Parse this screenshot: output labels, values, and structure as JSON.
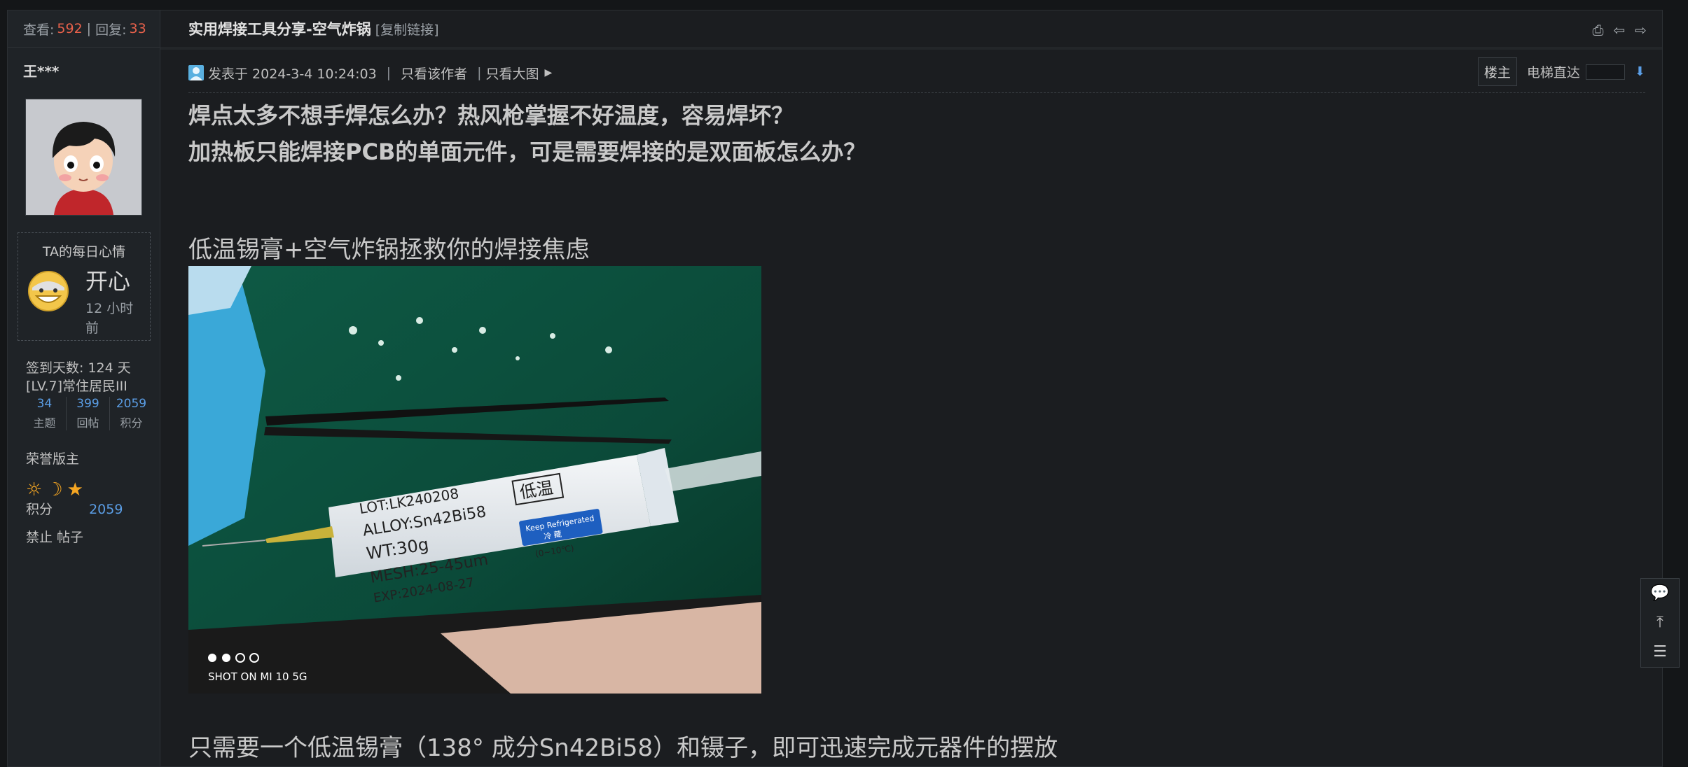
{
  "thread": {
    "views_label": "查看:",
    "views": "592",
    "separator": "|",
    "replies_label": "回复:",
    "replies": "33",
    "title": "实用焊接工具分享-空气炸锅",
    "copy_link": "[复制链接]"
  },
  "user": {
    "name": "王***",
    "mood_title": "TA的每日心情",
    "mood": "开心",
    "mood_time": "12 小时前",
    "checkin": "签到天数: 124 天",
    "level": "[LV.7]常住居民III",
    "stats": [
      {
        "value": "34",
        "label": "主题"
      },
      {
        "value": "399",
        "label": "回帖"
      },
      {
        "value": "2059",
        "label": "积分"
      }
    ],
    "honor": "荣誉版主",
    "points_label": "积分",
    "points": "2059",
    "banned": "禁止 帖子"
  },
  "post": {
    "posted": "发表于 2024-3-4 10:24:03",
    "only_author": "只看该作者",
    "big_image": "只看大图",
    "floor": "楼主",
    "elevator": "电梯直达",
    "line1": "焊点太多不想手焊怎么办？热风枪掌握不好温度，容易焊坏？",
    "line2": "加热板只能焊接PCB的单面元件，可是需要焊接的是双面板怎么办？",
    "heading": "低温锡膏+空气炸锅拯救你的焊接焦虑",
    "photo_label_lot": "LOT:LK240208",
    "photo_label_temp": "低温",
    "photo_label_alloy": "ALLOY:Sn42Bi58",
    "photo_label_wt": "WT:30g",
    "photo_label_mesh": "MESH:25-45um",
    "photo_label_exp": "EXP:2024-08-27",
    "photo_sticker": "Keep Refrigerated",
    "photo_sticker2": "冷 藏",
    "photo_range": "(0~10℃)",
    "photo_watermark": "SHOT ON MI 10 5G",
    "caption": "只需要一个低温锡膏（138° 成分Sn42Bi58）和镊子，即可迅速完成元器件的摆放"
  }
}
